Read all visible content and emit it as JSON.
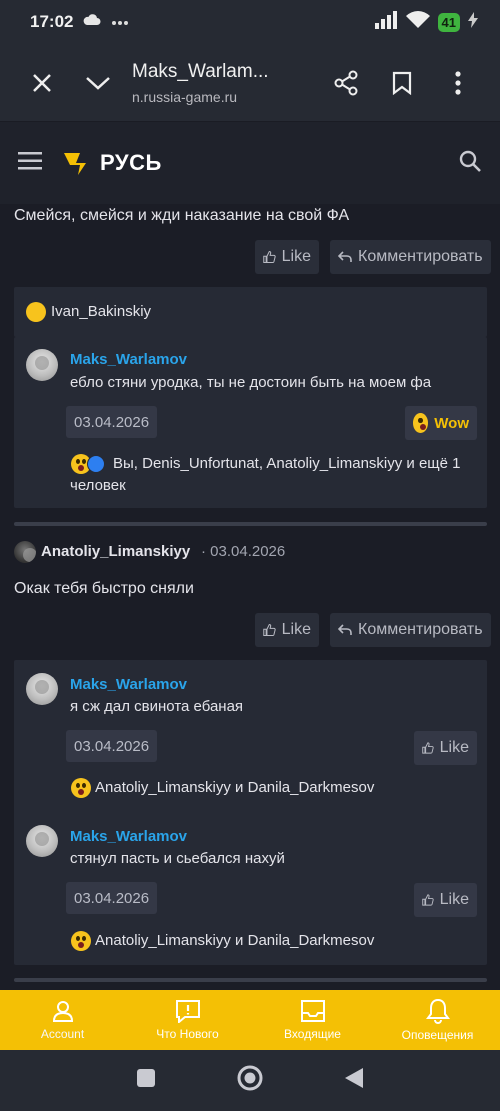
{
  "status": {
    "time": "17:02",
    "battery": "41"
  },
  "browser": {
    "title": "Maks_Warlam...",
    "url": "n.russia-game.ru"
  },
  "site": {
    "logo_text": "РУСЬ"
  },
  "post1": {
    "text": "Смейся, смейся и жди наказание на свой ФА",
    "like_label": "Like",
    "comment_label": "Комментировать",
    "reaction_user": "Ivan_Bakinskiy"
  },
  "reply1": {
    "username": "Maks_Warlamov",
    "text": "ебло стяни уродка, ты не достоин быть на моем фа",
    "date": "03.04.2026",
    "wow_label": "Wow",
    "reactors_line1": "Вы, Denis_Unfortunat, Anatoliy_Limanskiyy и ещё 1",
    "reactors_line2": "человек"
  },
  "post2": {
    "author": "Anatoliy_Limanskiyy",
    "date": "· 03.04.2026",
    "text": "Окак тебя быстро сняли",
    "like_label": "Like",
    "comment_label": "Комментировать"
  },
  "reply2": {
    "username": "Maks_Warlamov",
    "text": "я сж дал свинота ебаная",
    "date": "03.04.2026",
    "like_label": "Like",
    "reactors": "Anatoliy_Limanskiyy и Danila_Darkmesov"
  },
  "reply3": {
    "username": "Maks_Warlamov",
    "text": "стянул пасть и сьебался нахуй",
    "date": "03.04.2026",
    "like_label": "Like",
    "reactors": "Anatoliy_Limanskiyy и Danila_Darkmesov"
  },
  "bottom_nav": {
    "account": "Account",
    "whats_new": "Что Нового",
    "inbox": "Входящие",
    "alerts": "Оповещения"
  },
  "colors": {
    "accent": "#f4c005",
    "username": "#2aa4ea",
    "background": "#1b1d26"
  }
}
